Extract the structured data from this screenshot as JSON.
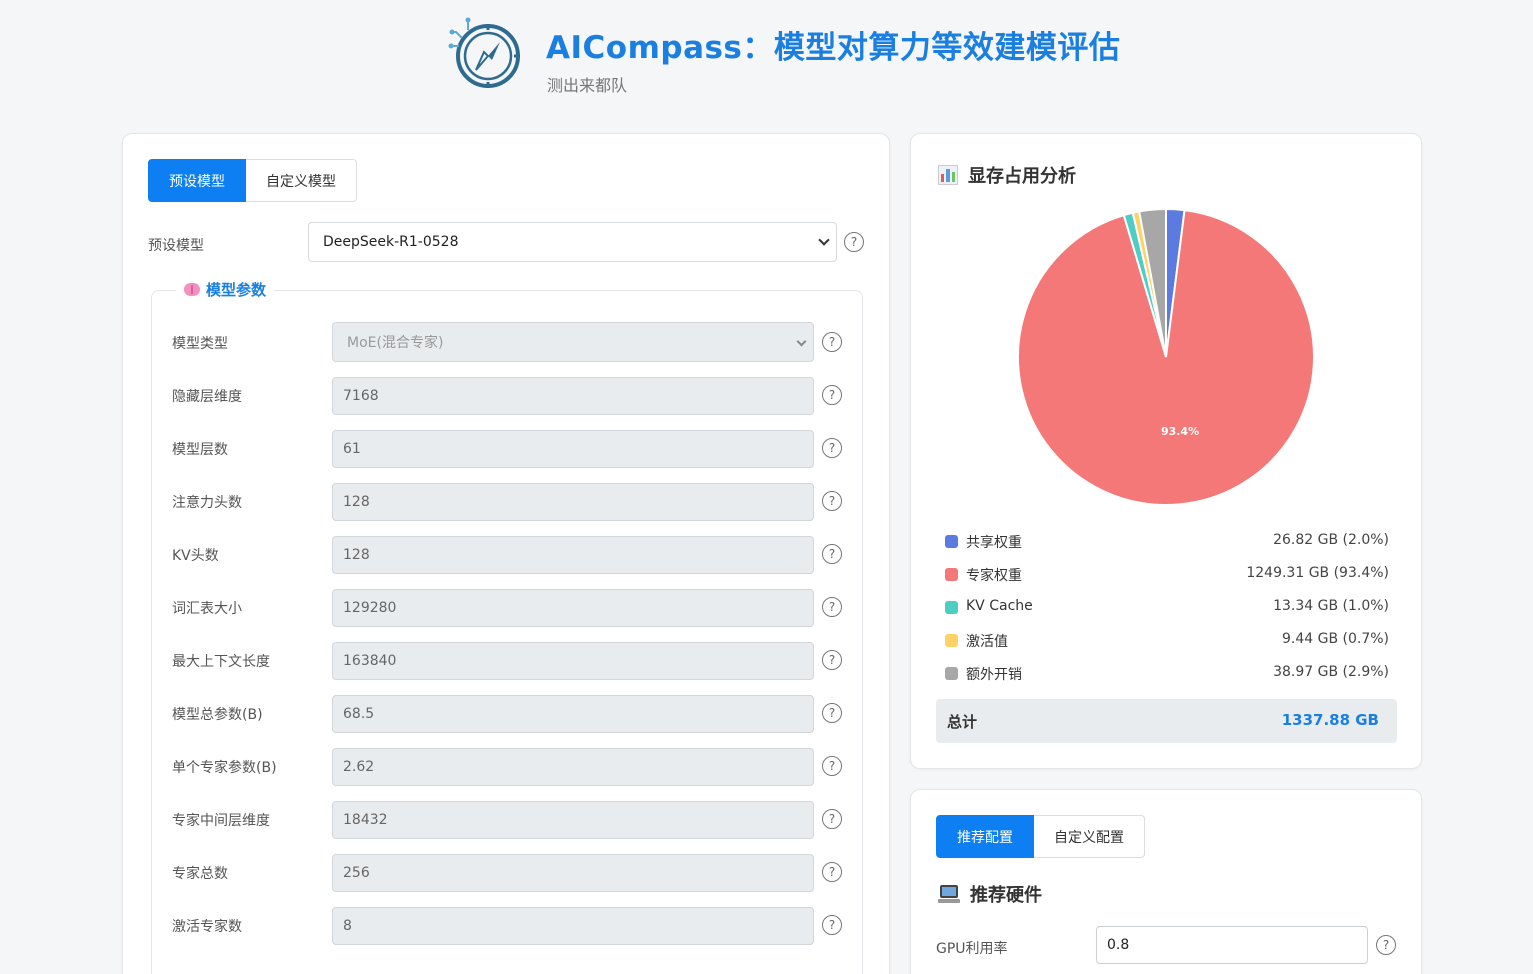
{
  "header": {
    "title": "AICompass：模型对算力等效建模评估",
    "subtitle": "测出来都队",
    "logo_icon": "compass-circuit-icon"
  },
  "model_panel": {
    "tabs": [
      {
        "label": "预设模型",
        "active": true
      },
      {
        "label": "自定义模型",
        "active": false
      }
    ],
    "preset_label": "预设模型",
    "preset_value": "DeepSeek-R1-0528",
    "params_title": "模型参数",
    "params": [
      {
        "label": "模型类型",
        "value": "MoE(混合专家)",
        "kind": "select"
      },
      {
        "label": "隐藏层维度",
        "value": "7168"
      },
      {
        "label": "模型层数",
        "value": "61"
      },
      {
        "label": "注意力头数",
        "value": "128"
      },
      {
        "label": "KV头数",
        "value": "128"
      },
      {
        "label": "词汇表大小",
        "value": "129280"
      },
      {
        "label": "最大上下文长度",
        "value": "163840"
      },
      {
        "label": "模型总参数(B)",
        "value": "68.5"
      },
      {
        "label": "单个专家参数(B)",
        "value": "2.62"
      },
      {
        "label": "专家中间层维度",
        "value": "18432"
      },
      {
        "label": "专家总数",
        "value": "256"
      },
      {
        "label": "激活专家数",
        "value": "8"
      }
    ],
    "help_glyph": "?"
  },
  "memory_panel": {
    "title": "显存占用分析",
    "icon": "bar-chart-icon",
    "pie_label": "93.4%",
    "legend": [
      {
        "name": "共享权重",
        "value": "26.82 GB (2.0%)",
        "color": "#5b7be0",
        "pct": 2.0
      },
      {
        "name": "专家权重",
        "value": "1249.31 GB (93.4%)",
        "color": "#f57878",
        "pct": 93.4
      },
      {
        "name": "KV Cache",
        "value": "13.34 GB (1.0%)",
        "color": "#4ecdc4",
        "pct": 1.0
      },
      {
        "name": "激活值",
        "value": "9.44 GB (0.7%)",
        "color": "#ffd166",
        "pct": 0.7
      },
      {
        "name": "额外开销",
        "value": "38.97 GB (2.9%)",
        "color": "#a7a7a7",
        "pct": 2.9
      }
    ],
    "total_label": "总计",
    "total_value": "1337.88 GB"
  },
  "hardware_panel": {
    "tabs": [
      {
        "label": "推荐配置",
        "active": true
      },
      {
        "label": "自定义配置",
        "active": false
      }
    ],
    "title": "推荐硬件",
    "icon": "computer-icon",
    "gpu_label": "GPU利用率",
    "gpu_value": "0.8"
  }
}
